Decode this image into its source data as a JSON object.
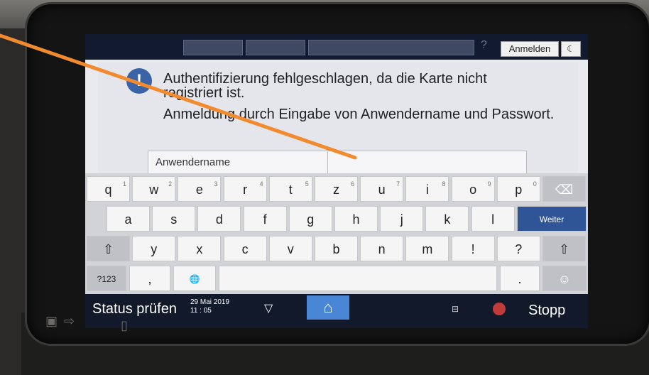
{
  "topbar": {
    "help": "?",
    "login_button": "Anmelden",
    "moon": "☾"
  },
  "message": {
    "line1": "Authentifizierung fehlgeschlagen, da die Karte nicht",
    "line2": "registriert ist.",
    "line3": "Anmeldung durch Eingabe von Anwendername und Passwort.",
    "icon": "!"
  },
  "field": {
    "label": "Anwendername",
    "value": ""
  },
  "keyboard": {
    "row1": [
      {
        "k": "q",
        "n": "1"
      },
      {
        "k": "w",
        "n": "2"
      },
      {
        "k": "e",
        "n": "3"
      },
      {
        "k": "r",
        "n": "4"
      },
      {
        "k": "t",
        "n": "5"
      },
      {
        "k": "z",
        "n": "6"
      },
      {
        "k": "u",
        "n": "7"
      },
      {
        "k": "i",
        "n": "8"
      },
      {
        "k": "o",
        "n": "9"
      },
      {
        "k": "p",
        "n": "0"
      },
      {
        "k": "⌫",
        "n": ""
      }
    ],
    "row2": [
      "a",
      "s",
      "d",
      "f",
      "g",
      "h",
      "j",
      "k",
      "l"
    ],
    "enter": "Weiter",
    "row3": [
      "⇧",
      "y",
      "x",
      "c",
      "v",
      "b",
      "n",
      "m",
      "!",
      "?",
      "⇧"
    ],
    "row4": {
      "num_key": "?123",
      "comma": ",",
      "globe": "🌐",
      "period": ".",
      "emoji": "☺"
    }
  },
  "bottombar": {
    "status": "Status prüfen",
    "date": "29 Mai 2019",
    "time": "11 : 05",
    "arrow": "▽",
    "home": "⌂",
    "memory": "⊟",
    "stop": "Stopp"
  }
}
